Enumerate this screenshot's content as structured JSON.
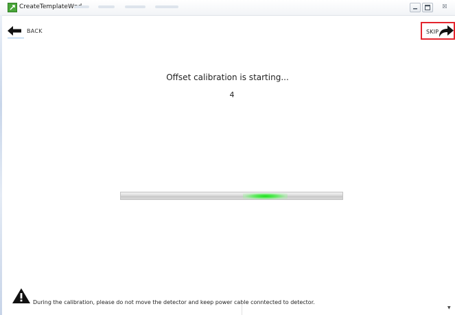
{
  "window": {
    "title": "CreateTemplateWnd",
    "controls": {
      "minimize_icon": "minimize-icon",
      "maximize_icon": "maximize-icon",
      "close_icon": "close-icon",
      "close_glyph": "☒"
    }
  },
  "nav": {
    "back_label": "BACK",
    "back_icon": "arrow-left-icon",
    "skip_label": "SKIP",
    "skip_icon": "arrow-curve-right-icon",
    "skip_highlight_color": "#e3232c"
  },
  "calibration": {
    "status_text": "Offset calibration is starting...",
    "countdown": "4",
    "progress_indicator_color": "#17e017",
    "progress_mode": "indeterminate"
  },
  "footer": {
    "warning_icon": "warning-triangle-icon",
    "warning_text": "During the calibration, please do not move the detector and keep power cable conntected to detector."
  },
  "colors": {
    "background": "#ffffff",
    "accent_edge": "#c8d6ea"
  }
}
